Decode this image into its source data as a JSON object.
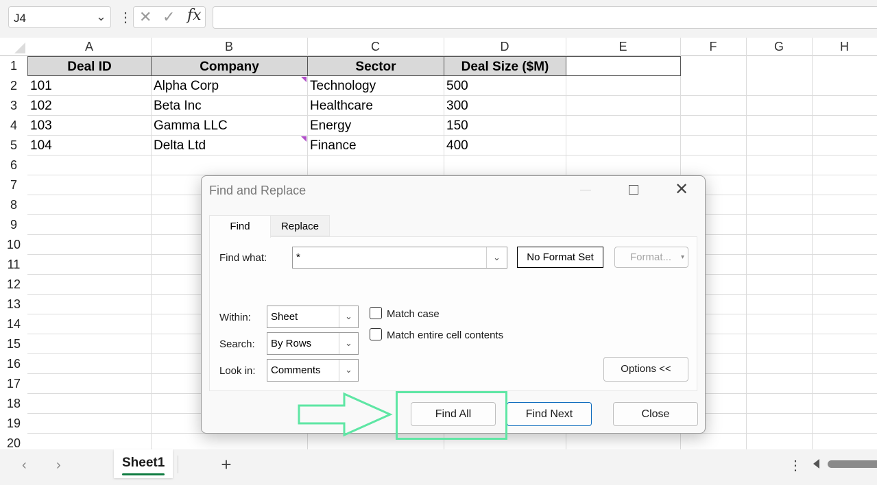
{
  "name_box": {
    "value": "J4"
  },
  "formula_bar": {
    "cancel_glyph": "✕",
    "enter_glyph": "✓",
    "fx_label": "fx",
    "value": ""
  },
  "columns": [
    "A",
    "B",
    "C",
    "D",
    "E",
    "F",
    "G",
    "H"
  ],
  "rows": [
    "1",
    "2",
    "3",
    "4",
    "5",
    "6",
    "7",
    "8",
    "9",
    "10",
    "11",
    "12",
    "13",
    "14",
    "15",
    "16",
    "17",
    "18",
    "19",
    "20"
  ],
  "table": {
    "headers": [
      "Deal ID",
      "Company",
      "Sector",
      "Deal Size ($M)"
    ],
    "rows": [
      [
        "101",
        "Alpha Corp",
        "Technology",
        "500"
      ],
      [
        "102",
        "Beta Inc",
        "Healthcare",
        "300"
      ],
      [
        "103",
        "Gamma LLC",
        "Energy",
        "150"
      ],
      [
        "104",
        "Delta Ltd",
        "Finance",
        "400"
      ]
    ]
  },
  "dialog": {
    "title": "Find and Replace",
    "tabs": {
      "find": "Find",
      "replace": "Replace"
    },
    "find_what": {
      "label": "Find what:",
      "value": "*"
    },
    "no_format_label": "No Format Set",
    "format_button": "Format...",
    "within": {
      "label": "Within:",
      "value": "Sheet"
    },
    "search": {
      "label": "Search:",
      "value": "By Rows"
    },
    "look_in": {
      "label": "Look in:",
      "value": "Comments"
    },
    "match_case": {
      "label": "Match case",
      "checked": false
    },
    "match_entire": {
      "label": "Match entire cell contents",
      "checked": false
    },
    "options_button": "Options <<",
    "find_all_button": "Find All",
    "find_next_button": "Find Next",
    "close_button": "Close"
  },
  "sheet_tabs": {
    "active": "Sheet1",
    "add_glyph": "+"
  },
  "colors": {
    "accent_green": "#5ee6a4",
    "header_gray": "#d9d9d9",
    "comment_marker": "#b050c8",
    "primary_border": "#0f6cbd"
  }
}
